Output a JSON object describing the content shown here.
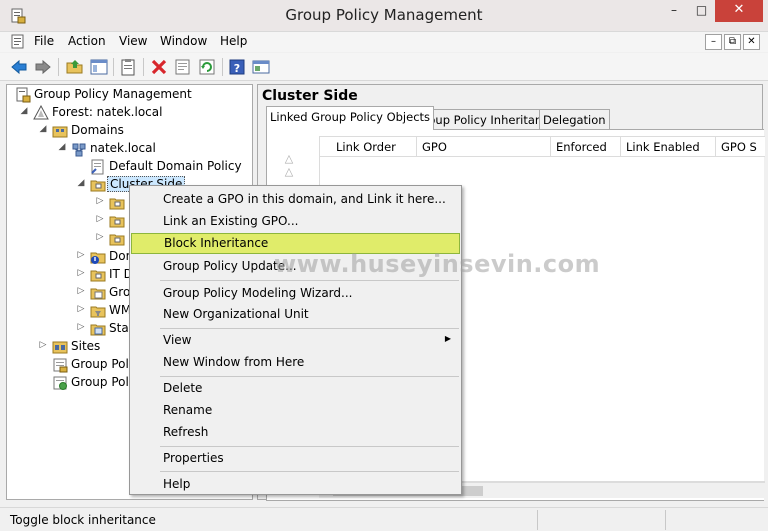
{
  "window": {
    "title": "Group Policy Management",
    "minimize": "–",
    "maximize": "□",
    "close": "✕"
  },
  "menubar": {
    "items": [
      "File",
      "Action",
      "View",
      "Window",
      "Help"
    ],
    "mdi_minimize": "–",
    "mdi_restore": "⧉",
    "mdi_close": "✕"
  },
  "toolbar": {
    "buttons": [
      "back-arrow-icon",
      "forward-arrow-icon",
      "up-folder-icon",
      "show-hide-tree-icon",
      "clipboard-icon",
      "delete-icon",
      "properties-icon",
      "refresh-icon",
      "help-icon",
      "console-icon"
    ]
  },
  "tree": {
    "items": [
      {
        "label": "Group Policy Management",
        "expander": "",
        "icon": "gpm-icon"
      },
      {
        "label": "Forest: natek.local",
        "expander": "◢",
        "icon": "forest-icon"
      },
      {
        "label": "Domains",
        "expander": "◢",
        "icon": "domains-icon"
      },
      {
        "label": "natek.local",
        "expander": "◢",
        "icon": "domain-icon"
      },
      {
        "label": "Default Domain Policy",
        "expander": "",
        "icon": "gpo-link-icon"
      },
      {
        "label": "Cluster Side",
        "expander": "◢",
        "icon": "ou-icon"
      },
      {
        "label": "",
        "expander": "▷",
        "icon": "ou-icon"
      },
      {
        "label": "",
        "expander": "▷",
        "icon": "ou-icon"
      },
      {
        "label": "",
        "expander": "▷",
        "icon": "ou-icon"
      },
      {
        "label": "Dom",
        "expander": "▷",
        "icon": "ou-blocked-icon"
      },
      {
        "label": "IT D",
        "expander": "▷",
        "icon": "ou-icon"
      },
      {
        "label": "Gro",
        "expander": "▷",
        "icon": "gpo-folder-icon"
      },
      {
        "label": "WM",
        "expander": "▷",
        "icon": "wmi-folder-icon"
      },
      {
        "label": "Star",
        "expander": "▷",
        "icon": "starter-gpo-icon"
      },
      {
        "label": "Sites",
        "expander": "▷",
        "icon": "sites-icon"
      },
      {
        "label": "Group Polic",
        "expander": "",
        "icon": "gp-modeling-icon"
      },
      {
        "label": "Group Polic",
        "expander": "",
        "icon": "gp-results-icon"
      }
    ]
  },
  "right_pane": {
    "title": "Cluster Side",
    "tabs": [
      "Linked Group Policy Objects",
      "Group Policy Inheritance",
      "Delegation"
    ],
    "columns": [
      "Link Order",
      "GPO",
      "Enforced",
      "Link Enabled",
      "GPO S"
    ]
  },
  "context_menu": {
    "items": [
      {
        "label": "Create a GPO in this domain, and Link it here...",
        "highlight": false
      },
      {
        "label": "Link an Existing GPO...",
        "highlight": false
      },
      {
        "label": "Block Inheritance",
        "highlight": true
      },
      {
        "label": "Group Policy Update...",
        "highlight": false
      },
      {
        "label": "Group Policy Modeling Wizard...",
        "highlight": false
      },
      {
        "label": "New Organizational Unit",
        "highlight": false
      },
      {
        "label": "View",
        "highlight": false,
        "submenu": true
      },
      {
        "label": "New Window from Here",
        "highlight": false
      },
      {
        "label": "Delete",
        "highlight": false
      },
      {
        "label": "Rename",
        "highlight": false
      },
      {
        "label": "Refresh",
        "highlight": false
      },
      {
        "label": "Properties",
        "highlight": false
      },
      {
        "label": "Help",
        "highlight": false
      }
    ],
    "submenu_arrow": "▶"
  },
  "statusbar": {
    "text": "Toggle block inheritance"
  },
  "watermark": "www.huseyinsevin.com",
  "colors": {
    "highlight": "#e0ec6a",
    "highlight_border": "#8db63c",
    "close_button": "#c9423a",
    "selection": "#cce8ff"
  }
}
